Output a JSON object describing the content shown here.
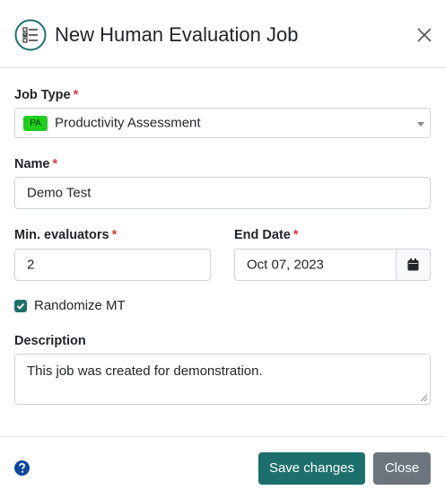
{
  "header": {
    "title": "New Human Evaluation Job",
    "icon": "checklist-icon"
  },
  "form": {
    "job_type": {
      "label": "Job Type",
      "required": "*",
      "badge": "PA",
      "badge_color": "#1ecf1e",
      "value": "Productivity Assessment"
    },
    "name": {
      "label": "Name",
      "required": "*",
      "value": "Demo Test"
    },
    "min_evaluators": {
      "label": "Min. evaluators",
      "required": "*",
      "value": "2"
    },
    "end_date": {
      "label": "End Date",
      "required": "*",
      "value": "Oct 07, 2023"
    },
    "randomize": {
      "label": "Randomize MT",
      "checked": true
    },
    "description": {
      "label": "Description",
      "value": "This job was created for demonstration."
    }
  },
  "footer": {
    "save_label": "Save changes",
    "close_label": "Close"
  },
  "colors": {
    "primary": "#1d6f6b",
    "secondary": "#6c757d",
    "required": "#dc3545",
    "help": "#0d47a1"
  }
}
